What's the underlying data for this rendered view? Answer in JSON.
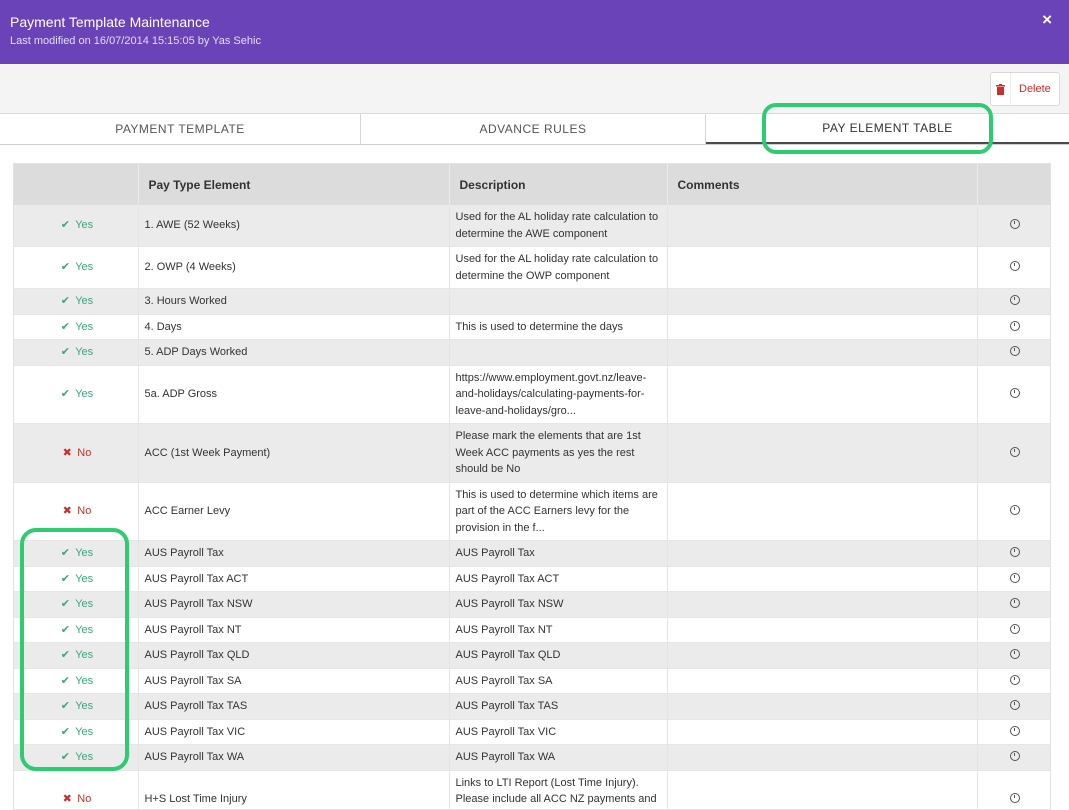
{
  "header": {
    "title": "Payment Template Maintenance",
    "subtitle": "Last modified on 16/07/2014 15:15:05 by Yas Sehic",
    "close_icon": "×"
  },
  "toolbar": {
    "delete_label": "Delete",
    "delete_icon": "trash-icon"
  },
  "tabs": [
    {
      "label": "PAYMENT TEMPLATE",
      "active": false
    },
    {
      "label": "ADVANCE RULES",
      "active": false
    },
    {
      "label": "PAY ELEMENT TABLE",
      "active": true
    }
  ],
  "colors": {
    "header": "#6a43b9",
    "yes": "#3aa77c",
    "no": "#c9302c",
    "highlight": "#2ecc71"
  },
  "table": {
    "columns": [
      "",
      "Pay Type Element",
      "Description",
      "Comments",
      ""
    ],
    "rows": [
      {
        "status": "Yes",
        "element": "1. AWE (52 Weeks)",
        "description": "Used for the AL holiday rate calculation to determine the AWE component",
        "comments": ""
      },
      {
        "status": "Yes",
        "element": "2. OWP (4 Weeks)",
        "description": "Used for the AL holiday rate calculation to determine the OWP component",
        "comments": ""
      },
      {
        "status": "Yes",
        "element": "3. Hours Worked",
        "description": "",
        "comments": ""
      },
      {
        "status": "Yes",
        "element": "4. Days",
        "description": "This is used to determine the days",
        "comments": ""
      },
      {
        "status": "Yes",
        "element": "5. ADP Days Worked",
        "description": "",
        "comments": ""
      },
      {
        "status": "Yes",
        "element": "5a. ADP Gross",
        "description": "https://www.employment.govt.nz/leave-and-holidays/calculating-payments-for-leave-and-holidays/gro...",
        "comments": ""
      },
      {
        "status": "No",
        "element": "ACC (1st Week Payment)",
        "description": "Please mark the elements that are 1st Week ACC payments as yes the rest should be No",
        "comments": ""
      },
      {
        "status": "No",
        "element": "ACC Earner Levy",
        "description": "This is used to determine which items are part of the ACC Earners levy for the provision in the f...",
        "comments": ""
      },
      {
        "status": "Yes",
        "element": "AUS Payroll Tax",
        "description": "AUS Payroll Tax",
        "comments": ""
      },
      {
        "status": "Yes",
        "element": "AUS Payroll Tax ACT",
        "description": "AUS Payroll Tax ACT",
        "comments": ""
      },
      {
        "status": "Yes",
        "element": "AUS Payroll Tax NSW",
        "description": "AUS Payroll Tax NSW",
        "comments": ""
      },
      {
        "status": "Yes",
        "element": "AUS Payroll Tax NT",
        "description": "AUS Payroll Tax NT",
        "comments": ""
      },
      {
        "status": "Yes",
        "element": "AUS Payroll Tax QLD",
        "description": "AUS Payroll Tax QLD",
        "comments": ""
      },
      {
        "status": "Yes",
        "element": "AUS Payroll Tax SA",
        "description": "AUS Payroll Tax SA",
        "comments": ""
      },
      {
        "status": "Yes",
        "element": "AUS Payroll Tax TAS",
        "description": "AUS Payroll Tax TAS",
        "comments": ""
      },
      {
        "status": "Yes",
        "element": "AUS Payroll Tax VIC",
        "description": "AUS Payroll Tax VIC",
        "comments": ""
      },
      {
        "status": "Yes",
        "element": "AUS Payroll Tax WA",
        "description": "AUS Payroll Tax WA",
        "comments": ""
      },
      {
        "status": "No",
        "element": "H+S Lost Time Injury",
        "description": "Links to LTI Report (Lost Time Injury). Please include all ACC NZ payments and work types.",
        "comments": ""
      }
    ]
  }
}
